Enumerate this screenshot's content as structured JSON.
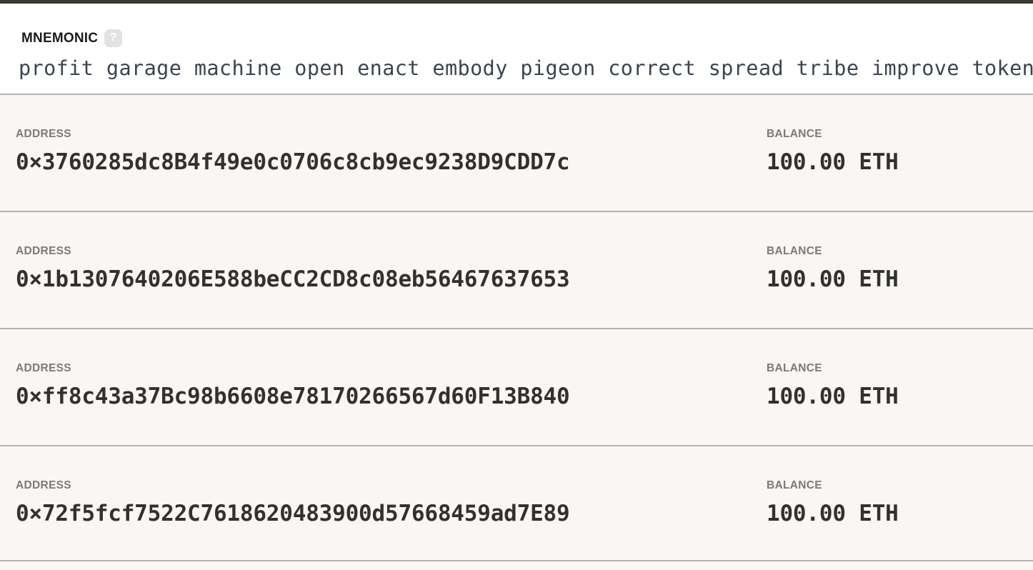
{
  "theme": {
    "top_strip_color": "#3c3832",
    "panel_bg": "#ffffff",
    "rows_bg": "#f8f7f5",
    "divider_color": "#b3b2b0",
    "label_color": "#7b7a78",
    "mono_value_color": "#33312e",
    "mnemonic_text_color": "#3b4451",
    "help_badge_bg": "#e2e2e2"
  },
  "mnemonic": {
    "label": "MNEMONIC",
    "help_icon": "question-mark-icon",
    "help_text": "?",
    "phrase": "profit garage machine open enact embody pigeon correct spread tribe improve token",
    "words": [
      "profit",
      "garage",
      "machine",
      "open",
      "enact",
      "embody",
      "pigeon",
      "correct",
      "spread",
      "tribe",
      "improve",
      "token"
    ]
  },
  "columns": {
    "address_label": "ADDRESS",
    "balance_label": "BALANCE"
  },
  "accounts": [
    {
      "address": "0×3760285dc8B4f49e0c0706c8cb9ec9238D9CDD7c",
      "balance": "100.00 ETH"
    },
    {
      "address": "0×1b1307640206E588beCC2CD8c08eb56467637653",
      "balance": "100.00 ETH"
    },
    {
      "address": "0×ff8c43a37Bc98b6608e78170266567d60F13B840",
      "balance": "100.00 ETH"
    },
    {
      "address": "0×72f5fcf7522C7618620483900d57668459ad7E89",
      "balance": "100.00 ETH"
    }
  ]
}
